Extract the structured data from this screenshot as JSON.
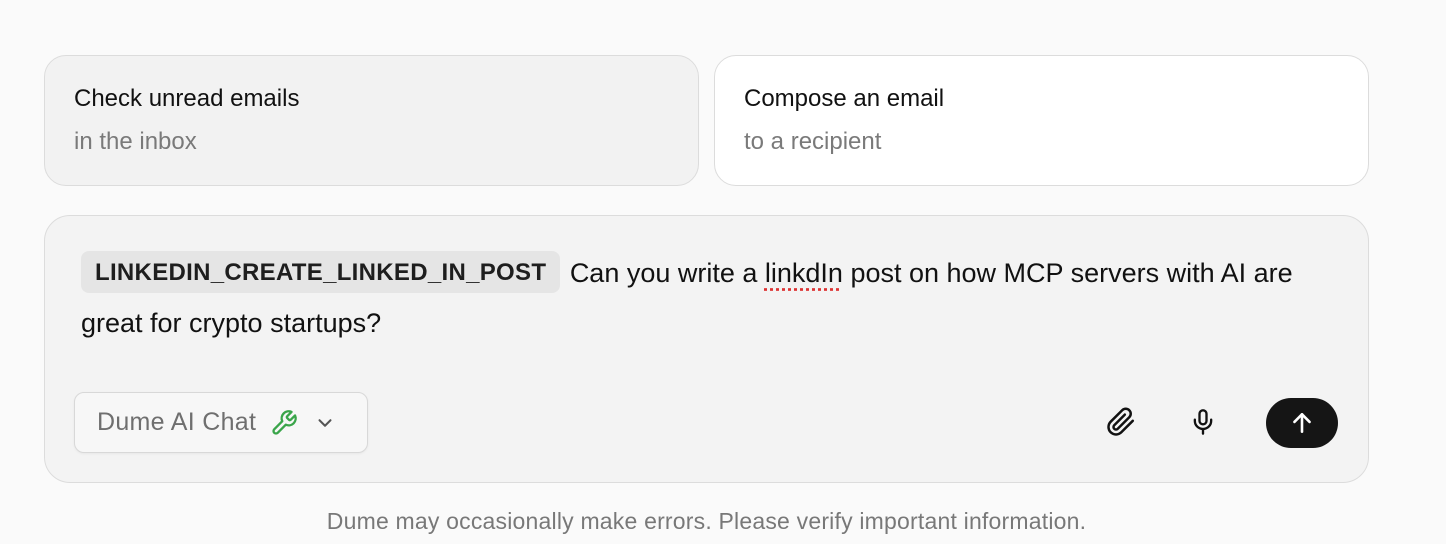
{
  "suggestions": [
    {
      "title": "Check unread emails",
      "subtitle": "in the inbox"
    },
    {
      "title": "Compose an email",
      "subtitle": "to a recipient"
    }
  ],
  "composer": {
    "tool_chip": "LINKEDIN_CREATE_LINKED_IN_POST",
    "text_before": "Can you write a ",
    "misspelled_word": "linkdIn",
    "text_after": " post on how MCP servers with AI are great for crypto startups?",
    "model_label": "Dume AI Chat",
    "icons": {
      "model_tools": "wrench-icon",
      "model_dropdown": "chevron-down-icon",
      "attach": "paperclip-icon",
      "voice": "microphone-icon",
      "send": "arrow-up-icon"
    },
    "colors": {
      "wrench": "#3aa54a",
      "send_bg": "#151515"
    }
  },
  "footer": {
    "disclaimer": "Dume may occasionally make errors. Please verify important information."
  }
}
